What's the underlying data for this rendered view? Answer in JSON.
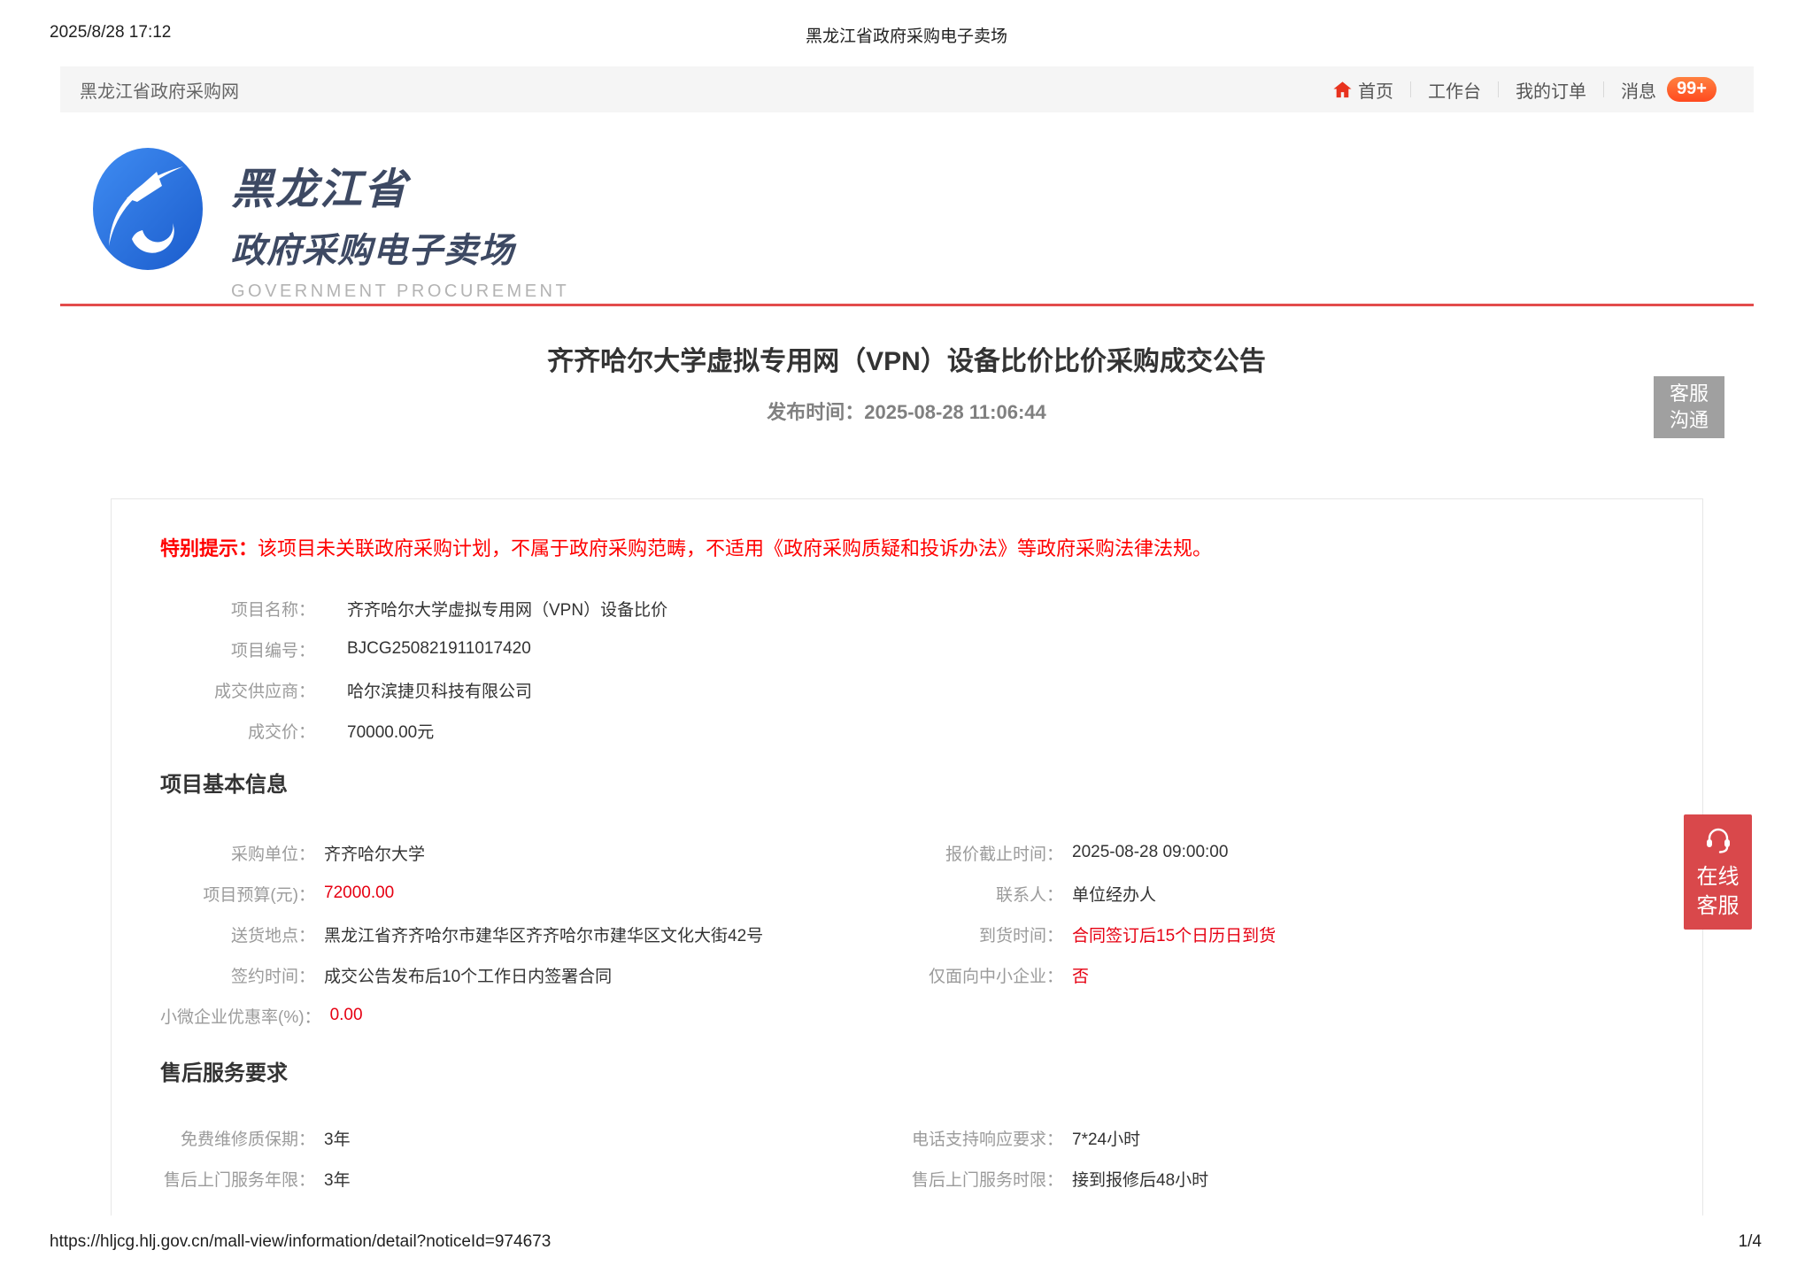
{
  "print_header": {
    "datetime": "2025/8/28 17:12",
    "doc_title": "黑龙江省政府采购电子卖场"
  },
  "navbar": {
    "site_name": "黑龙江省政府采购网",
    "home": "首页",
    "workbench": "工作台",
    "my_orders": "我的订单",
    "messages": "消息",
    "message_badge": "99+"
  },
  "logo": {
    "line1": "黑龙江省",
    "line2": "政府采购电子卖场",
    "line3": "GOVERNMENT PROCUREMENT"
  },
  "notice": {
    "title": "齐齐哈尔大学虚拟专用网（VPN）设备比价比价采购成交公告",
    "publish_label": "发布时间：",
    "publish_time": "2025-08-28 11:06:44"
  },
  "kf_button": {
    "line1": "客服",
    "line2": "沟通"
  },
  "online_kf": {
    "line1": "在线",
    "line2": "客服"
  },
  "tip": {
    "label": "特别提示：",
    "text": "该项目未关联政府采购计划，不属于政府采购范畴，不适用《政府采购质疑和投诉办法》等政府采购法律法规。"
  },
  "summary": {
    "rows": [
      {
        "label": "项目名称：",
        "value": "齐齐哈尔大学虚拟专用网（VPN）设备比价"
      },
      {
        "label": "项目编号：",
        "value": "BJCG250821911017420"
      },
      {
        "label": "成交供应商：",
        "value": "哈尔滨捷贝科技有限公司"
      },
      {
        "label": "成交价：",
        "value": "70000.00元"
      }
    ]
  },
  "basic_info": {
    "heading": "项目基本信息",
    "rows": [
      {
        "left": {
          "label": "采购单位：",
          "value": "齐齐哈尔大学",
          "red": false
        },
        "right": {
          "label": "报价截止时间：",
          "value": "2025-08-28 09:00:00",
          "red": false
        }
      },
      {
        "left": {
          "label": "项目预算(元)：",
          "value": "72000.00",
          "red": true
        },
        "right": {
          "label": "联系人：",
          "value": "单位经办人",
          "red": false
        }
      },
      {
        "left": {
          "label": "送货地点：",
          "value": "黑龙江省齐齐哈尔市建华区齐齐哈尔市建华区文化大街42号",
          "red": false
        },
        "right": {
          "label": "到货时间：",
          "value": "合同签订后15个日历日到货",
          "red": true
        }
      },
      {
        "left": {
          "label": "签约时间：",
          "value": "成交公告发布后10个工作日内签署合同",
          "red": false
        },
        "right": {
          "label": "仅面向中小企业：",
          "value": "否",
          "red": true
        }
      },
      {
        "left": {
          "label": "小微企业优惠率(%)：",
          "value": "0.00",
          "red": true
        }
      }
    ]
  },
  "after_sale": {
    "heading": "售后服务要求",
    "rows": [
      {
        "left": {
          "label": "免费维修质保期：",
          "value": "3年"
        },
        "right": {
          "label": "电话支持响应要求：",
          "value": "7*24小时"
        }
      },
      {
        "left": {
          "label": "售后上门服务年限：",
          "value": "3年"
        },
        "right": {
          "label": "售后上门服务时限：",
          "value": "接到报修后48小时"
        }
      }
    ]
  },
  "footer": {
    "url": "https://hljcg.hlj.gov.cn/mall-view/information/detail?noticeId=974673",
    "page": "1/4"
  },
  "colors": {
    "accent_red_line": "#e34c4c",
    "value_red": "#e60012",
    "tip_red": "#ff0000",
    "badge_orange": "#ff5b26",
    "kf_gray": "#a0a0a0",
    "online_kf_red": "#d9484b",
    "logo_blue": "#2e77e6"
  },
  "icons": {
    "home": "home-icon",
    "headset": "headset-icon",
    "logo": "dragon-logo-icon"
  }
}
